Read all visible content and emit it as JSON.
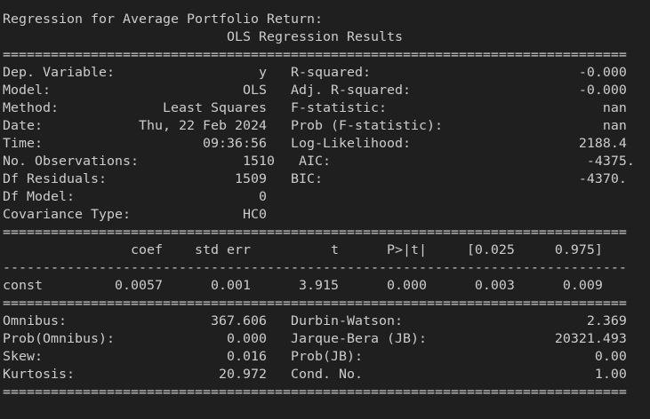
{
  "output": {
    "heading": "Regression for Average Portfolio Return:",
    "title": "OLS Regression Results",
    "header": [
      {
        "label": "Dep. Variable:",
        "value": "y",
        "stat_label": "R-squared:",
        "stat_value": "-0.000"
      },
      {
        "label": "Model:",
        "value": "OLS",
        "stat_label": "Adj. R-squared:",
        "stat_value": "-0.000"
      },
      {
        "label": "Method:",
        "value": "Least Squares",
        "stat_label": "F-statistic:",
        "stat_value": "nan"
      },
      {
        "label": "Date:",
        "value": "Thu, 22 Feb 2024",
        "stat_label": "Prob (F-statistic):",
        "stat_value": "nan"
      },
      {
        "label": "Time:",
        "value": "09:36:56",
        "stat_label": "Log-Likelihood:",
        "stat_value": "2188.4"
      },
      {
        "label": "No. Observations:",
        "value": "1510",
        "stat_label": "AIC:",
        "stat_value": "-4375."
      },
      {
        "label": "Df Residuals:",
        "value": "1509",
        "stat_label": "BIC:",
        "stat_value": "-4370."
      },
      {
        "label": "Df Model:",
        "value": "0",
        "stat_label": "",
        "stat_value": ""
      },
      {
        "label": "Covariance Type:",
        "value": "HC0",
        "stat_label": "",
        "stat_value": ""
      }
    ],
    "coef_table": {
      "columns": [
        "",
        "coef",
        "std err",
        "t",
        "P>|t|",
        "[0.025",
        "0.975]"
      ],
      "rows": [
        [
          "const",
          "0.0057",
          "0.001",
          "3.915",
          "0.000",
          "0.003",
          "0.009"
        ]
      ]
    },
    "diagnostics": [
      {
        "label": "Omnibus:",
        "value": "367.606",
        "stat_label": "Durbin-Watson:",
        "stat_value": "2.369"
      },
      {
        "label": "Prob(Omnibus):",
        "value": "0.000",
        "stat_label": "Jarque-Bera (JB):",
        "stat_value": "20321.493"
      },
      {
        "label": "Skew:",
        "value": "0.016",
        "stat_label": "Prob(JB):",
        "stat_value": "0.00"
      },
      {
        "label": "Kurtosis:",
        "value": "20.972",
        "stat_label": "Cond. No.",
        "stat_value": "1.00"
      }
    ],
    "double_rule_char": "=",
    "single_rule_char": "-"
  }
}
